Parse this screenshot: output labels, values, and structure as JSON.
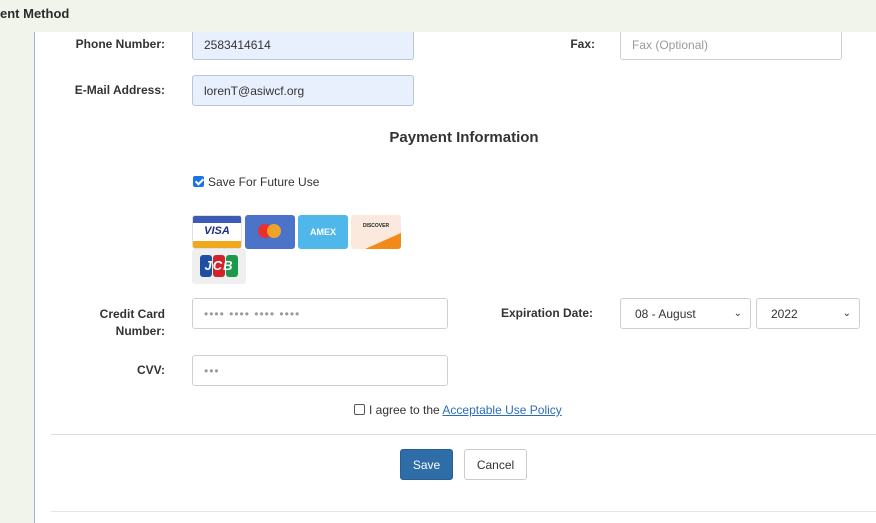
{
  "header": {
    "title": "ent Method"
  },
  "contact": {
    "phone_label": "Phone Number:",
    "phone_value": "2583414614",
    "fax_label": "Fax:",
    "fax_placeholder": "Fax (Optional)",
    "email_label": "E-Mail Address:",
    "email_value": "lorenT@asiwcf.org"
  },
  "payment": {
    "section_title": "Payment Information",
    "save_future_label": "Save For Future Use",
    "save_future_checked": true,
    "cards": [
      {
        "name": "VISA"
      },
      {
        "name": "MASTERCARD"
      },
      {
        "name": "AMEX"
      },
      {
        "name": "DISCOVER"
      },
      {
        "name": "JCB"
      }
    ],
    "cc_label_line1": "Credit Card",
    "cc_label_line2": "Number:",
    "cc_placeholder": "•••• •••• •••• ••••",
    "exp_label": "Expiration Date:",
    "exp_month": "08 - August",
    "exp_year": "2022",
    "cvv_label": "CVV:",
    "cvv_placeholder": "•••",
    "agree_text": "I agree to the ",
    "agree_link": "Acceptable Use Policy"
  },
  "buttons": {
    "save": "Save",
    "cancel": "Cancel"
  },
  "colors": {
    "primary": "#2f6da8",
    "link": "#2a6ebb",
    "autofill": "#e8f0fe"
  }
}
